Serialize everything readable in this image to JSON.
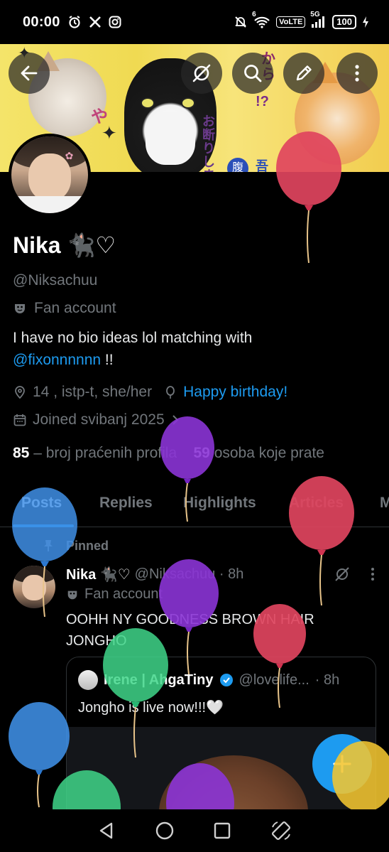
{
  "status": {
    "time": "00:00",
    "volte": "VoLTE",
    "network": "5G",
    "battery": "100",
    "wifi_badge": "6"
  },
  "profile": {
    "name": "Nika 🐈‍⬛♡",
    "handle": "@Niksachuu",
    "category": "Fan account",
    "bio_text": "I have no bio ideas lol   matching with",
    "bio_mention": "@fixonnnnnn",
    "bio_suffix": " !!",
    "location": "14 , istp-t, she/her",
    "birthday": "Happy birthday!",
    "joined": "Joined svibanj 2025",
    "following_count": "85",
    "following_label": "– broj praćenih profila",
    "followers_count": "59",
    "followers_label": "osoba koje prate"
  },
  "tabs": [
    "Posts",
    "Replies",
    "Highlights",
    "Articles",
    "M"
  ],
  "tweet": {
    "pinned_label": "Pinned",
    "name": "Nika 🐈‍⬛♡",
    "handle_time": "@Niksachuu · 8h",
    "category": "Fan account",
    "text": "OOHH NY GOODNESS BROWN HAIR JONGHO",
    "quote": {
      "name": "Irene | AhgaTiny",
      "handle": "@lovelife...",
      "time": "· 8h",
      "text": "Jongho is live now!!!🤍"
    }
  },
  "banner_text": {
    "a": "お断りします",
    "b": "から",
    "c": "腹",
    "d": "吾",
    "e": "や",
    "f": "!?"
  },
  "colors": {
    "accent": "#1d9bf0",
    "muted": "#71767b",
    "balloon_red": "#e0445e",
    "balloon_purple": "#8b34d6",
    "balloon_blue": "#3f8fe6",
    "balloon_green": "#3fd68a",
    "balloon_yellow": "#f2c530"
  },
  "icons": {
    "back": "arrow-left-icon",
    "grok": "grok-icon",
    "search": "search-icon",
    "edit": "edit-icon",
    "more": "more-vertical-icon"
  }
}
